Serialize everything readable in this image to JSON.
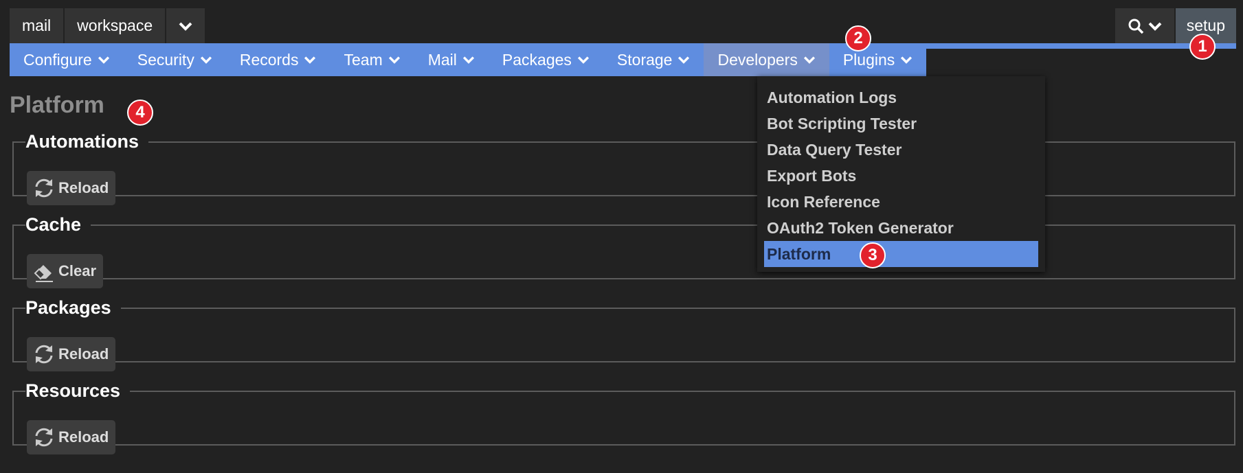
{
  "top_tabs": [
    "mail",
    "workspace"
  ],
  "setup_label": "setup",
  "nav": {
    "items": [
      "Configure",
      "Security",
      "Records",
      "Team",
      "Mail",
      "Packages",
      "Storage",
      "Developers",
      "Plugins"
    ],
    "active": "Developers"
  },
  "page_title": "Platform",
  "sections": [
    {
      "title": "Automations",
      "button": "Reload",
      "icon": "refresh-icon"
    },
    {
      "title": "Cache",
      "button": "Clear",
      "icon": "eraser-icon"
    },
    {
      "title": "Packages",
      "button": "Reload",
      "icon": "refresh-icon"
    },
    {
      "title": "Resources",
      "button": "Reload",
      "icon": "refresh-icon"
    }
  ],
  "dropdown": {
    "items": [
      "Automation Logs",
      "Bot Scripting Tester",
      "Data Query Tester",
      "Export Bots",
      "Icon Reference",
      "OAuth2 Token Generator",
      "Platform"
    ],
    "selected": "Platform"
  },
  "badges": [
    "1",
    "2",
    "3",
    "4"
  ],
  "colors": {
    "accent": "#5f8de0",
    "badge": "#e2222c",
    "background": "#222222"
  }
}
